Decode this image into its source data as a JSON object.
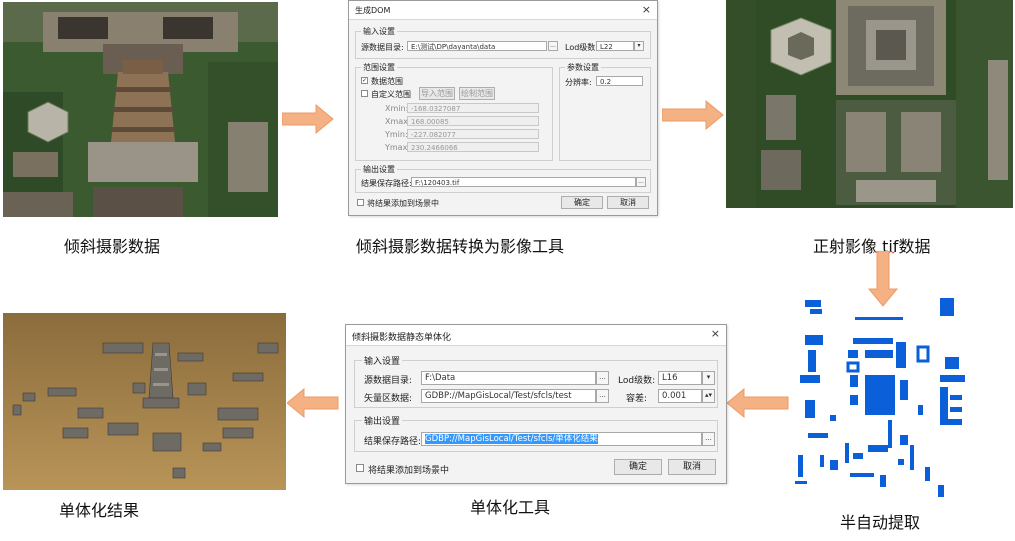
{
  "captions": {
    "oblique_data": "倾斜摄影数据",
    "convert_tool": "倾斜摄影数据转换为影像工具",
    "ortho_tif": "正射影像 tif数据",
    "semi_auto": "半自动提取",
    "monomer_tool": "单体化工具",
    "monomer_result": "单体化结果"
  },
  "dialog_dom": {
    "title": "生成DOM",
    "close": "×",
    "input_group": "输入设置",
    "source_label": "源数据目录:",
    "source_value": "E:\\测试\\DP\\dayanta\\data",
    "browse": "...",
    "lod_label": "Lod级数:",
    "lod_value": "L22",
    "dropdown": "▾",
    "range_group": "范围设置",
    "data_range": "数据范围",
    "custom_range": "自定义范围",
    "import_range": "导入范围",
    "draw_range": "绘制范围",
    "xmin_label": "Xmin:",
    "xmin_value": "-168.0327087",
    "xmax_label": "Xmax:",
    "xmax_value": "168.00085",
    "ymin_label": "Ymin:",
    "ymin_value": "-227.082077",
    "ymax_label": "Ymax:",
    "ymax_value": "230.2466066",
    "param_group": "参数设置",
    "resolution_label": "分辨率:",
    "resolution_value": "0.2",
    "output_group": "输出设置",
    "save_label": "结果保存路径:",
    "save_value": "F:\\120403.tif",
    "add_result": "将结果添加到场景中",
    "ok": "确定",
    "cancel": "取消",
    "check_mark": "✓"
  },
  "dialog_mono": {
    "title": "倾斜摄影数据静态单体化",
    "close": "×",
    "input_group": "输入设置",
    "source_label": "源数据目录:",
    "source_value": "F:\\Data",
    "browse": "...",
    "lod_label": "Lod级数:",
    "lod_value": "L16",
    "dropdown": "▾",
    "vector_label": "矢量区数据:",
    "vector_value": "GDBP://MapGisLocal/Test/sfcls/test",
    "tolerance_label": "容差:",
    "tolerance_value": "0.001",
    "spin": "▴▾",
    "output_group": "输出设置",
    "save_label": "结果保存路径:",
    "save_value": "GDBP://MapGisLocal/Test/sfcls/单体化结果",
    "add_result": "将结果添加到场景中",
    "ok": "确定",
    "cancel": "取消"
  },
  "colors": {
    "arrow": "#f4b183",
    "arrow_stroke": "#ed9b66",
    "extract_blue": "#0b5fd8"
  }
}
